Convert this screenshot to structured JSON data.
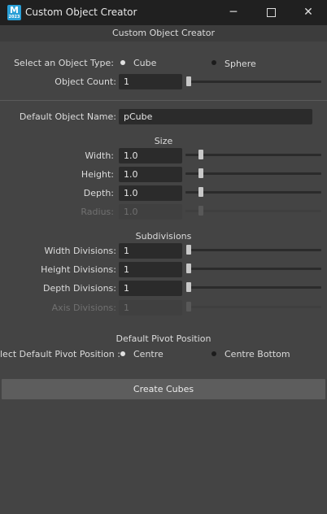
{
  "window": {
    "title": "Custom Object Creator",
    "app_icon": "M",
    "app_icon_sub": "2023",
    "minimize_glyph": "─",
    "close_glyph": "✕"
  },
  "header": {
    "title": "Custom Object Creator"
  },
  "object_type": {
    "label": "Select an Object Type:",
    "options": [
      "Cube",
      "Sphere"
    ],
    "selected": "Cube"
  },
  "object_count": {
    "label": "Object Count:",
    "value": "1"
  },
  "default_name": {
    "label": "Default Object Name:",
    "value": "pCube"
  },
  "size": {
    "title": "Size",
    "width": {
      "label": "Width:",
      "value": "1.0"
    },
    "height": {
      "label": "Height:",
      "value": "1.0"
    },
    "depth": {
      "label": "Depth:",
      "value": "1.0"
    },
    "radius": {
      "label": "Radius:",
      "value": "1.0"
    }
  },
  "subdivisions": {
    "title": "Subdivisions",
    "width": {
      "label": "Width Divisions:",
      "value": "1"
    },
    "height": {
      "label": "Height Divisions:",
      "value": "1"
    },
    "depth": {
      "label": "Depth Divisions:",
      "value": "1"
    },
    "axis": {
      "label": "Axis Divisions:",
      "value": "1"
    }
  },
  "pivot": {
    "title": "Default Pivot Position",
    "label": "lect Default Pivot Position :",
    "options": [
      "Centre",
      "Centre Bottom"
    ],
    "selected": "Centre"
  },
  "create_button": {
    "label": "Create Cubes"
  },
  "colors": {
    "background": "#444444",
    "titlebar": "#202020",
    "field": "#2b2b2b",
    "button": "#5d5d5d",
    "icon_blue": "#2a9fd6"
  }
}
